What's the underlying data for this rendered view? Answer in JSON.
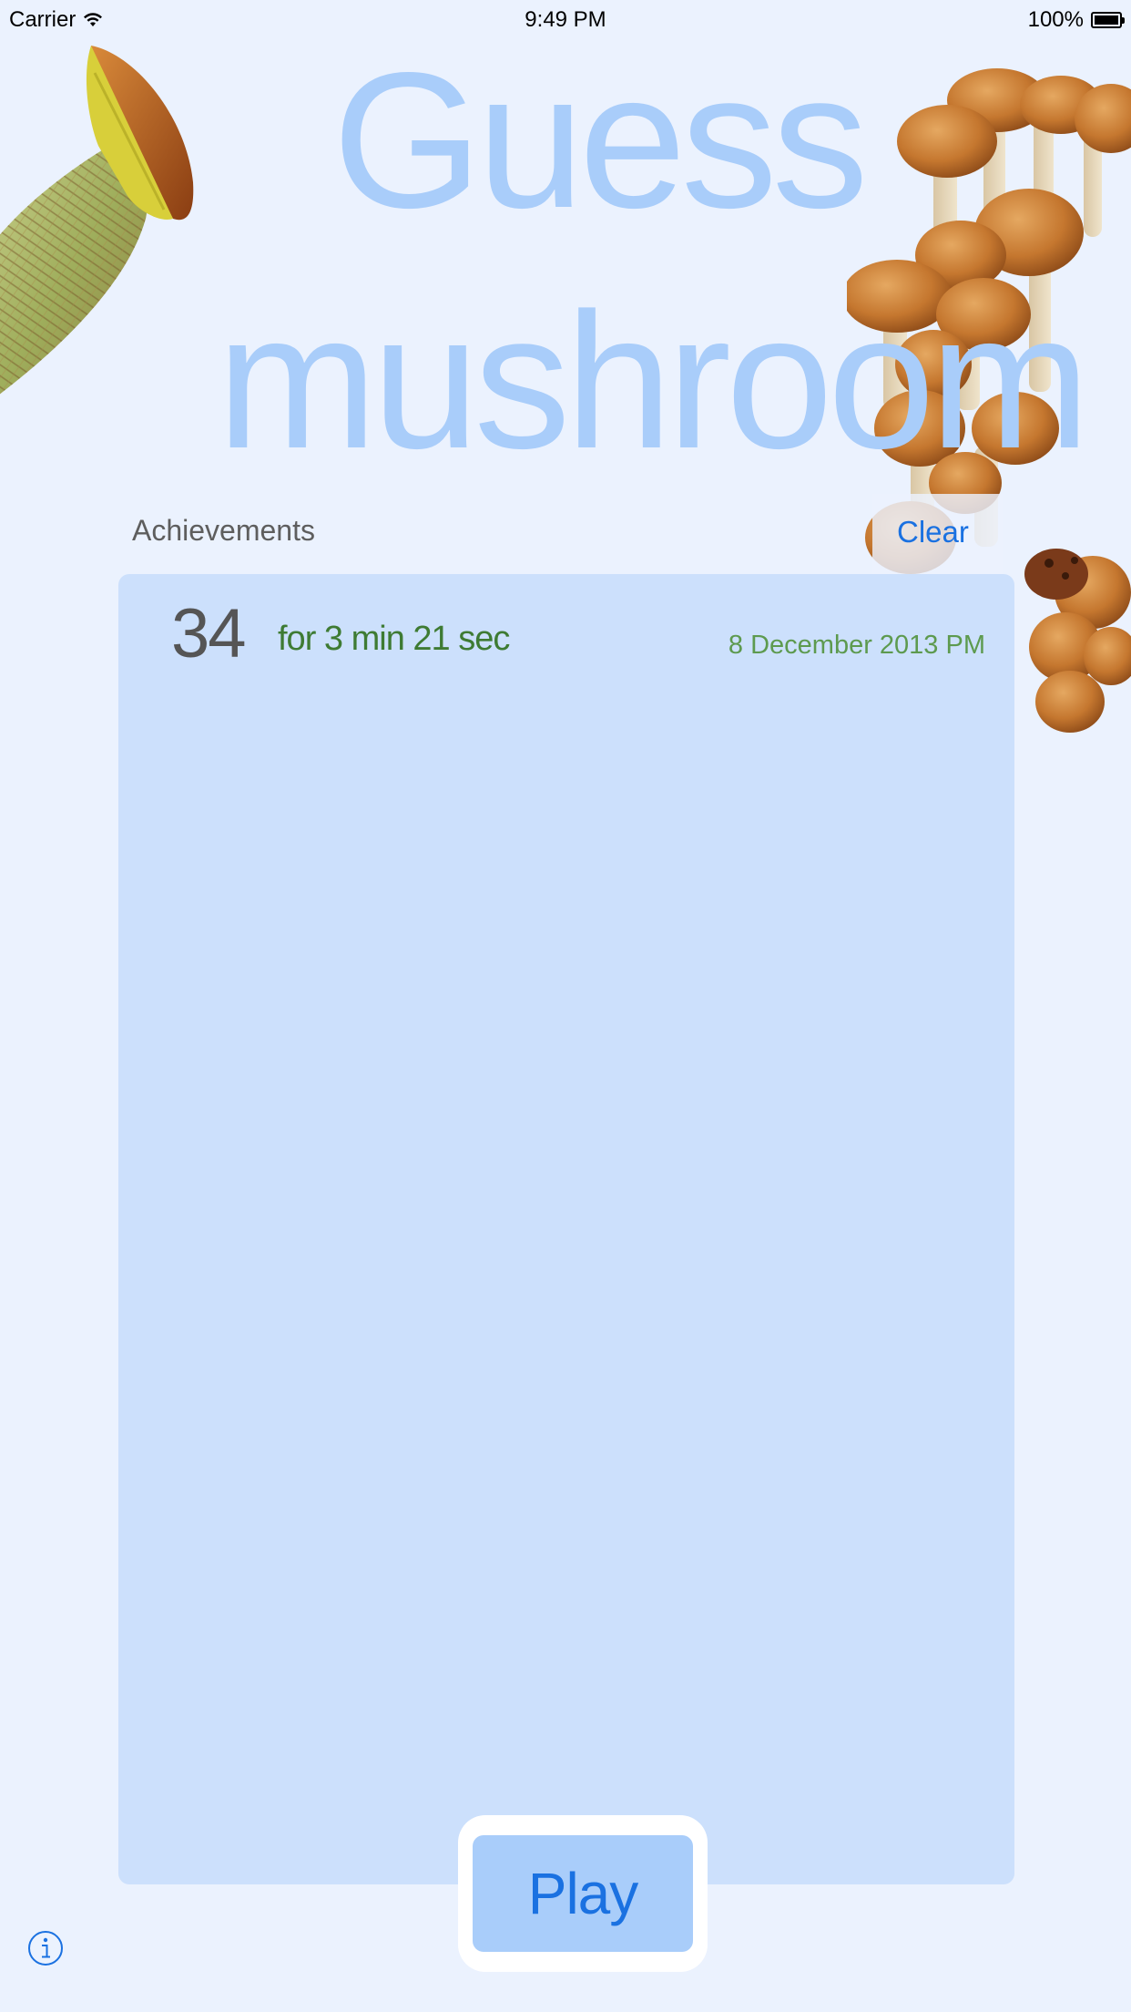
{
  "status_bar": {
    "carrier": "Carrier",
    "time": "9:49 PM",
    "battery_percent": "100%",
    "wifi_icon": "wifi-icon",
    "battery_icon": "battery-icon"
  },
  "title": {
    "line1": "Guess",
    "line2": "mushroom"
  },
  "achievements": {
    "label": "Achievements",
    "clear_label": "Clear",
    "entries": [
      {
        "score": "34",
        "duration": "for 3 min 21 sec",
        "date": "8 December 2013 PM"
      }
    ]
  },
  "play_label": "Play",
  "info_icon": "info-icon",
  "colors": {
    "background": "#ebf2fe",
    "title": "#a9cdfa",
    "panel": "#cce0fc",
    "accent": "#1a71e1",
    "duration_text": "#3e7b33",
    "date_text": "#5d9a4f"
  }
}
